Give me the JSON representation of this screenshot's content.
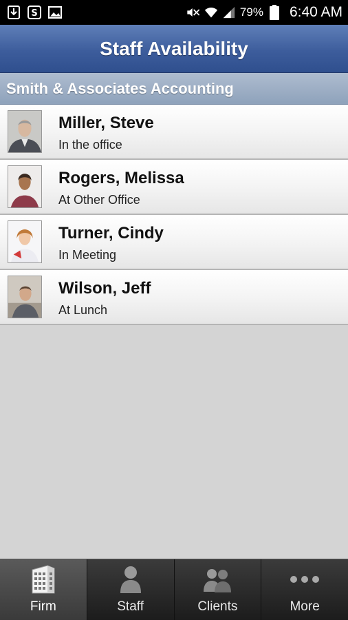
{
  "status_bar": {
    "left_icons": [
      "download-icon",
      "skype-icon",
      "image-icon"
    ],
    "right_icons": [
      "mute-icon",
      "wifi-icon",
      "signal-icon",
      "battery-icon"
    ],
    "battery_percent": "79%",
    "time": "6:40 AM"
  },
  "header": {
    "title": "Staff Availability"
  },
  "section": {
    "title": "Smith & Associates Accounting"
  },
  "staff": [
    {
      "name": "Miller, Steve",
      "status": "In the office"
    },
    {
      "name": "Rogers, Melissa",
      "status": "At Other Office"
    },
    {
      "name": "Turner, Cindy",
      "status": "In Meeting"
    },
    {
      "name": "Wilson, Jeff",
      "status": "At Lunch"
    }
  ],
  "tabs": [
    {
      "label": "Firm",
      "icon": "building-icon",
      "active": true
    },
    {
      "label": "Staff",
      "icon": "person-icon",
      "active": false
    },
    {
      "label": "Clients",
      "icon": "people-icon",
      "active": false
    },
    {
      "label": "More",
      "icon": "more-dots-icon",
      "active": false
    }
  ],
  "colors": {
    "title_bar": "#3d5d9c",
    "section_header": "#9aaec6",
    "background": "#d4d4d4",
    "tab_bar": "#2a2a2a"
  }
}
